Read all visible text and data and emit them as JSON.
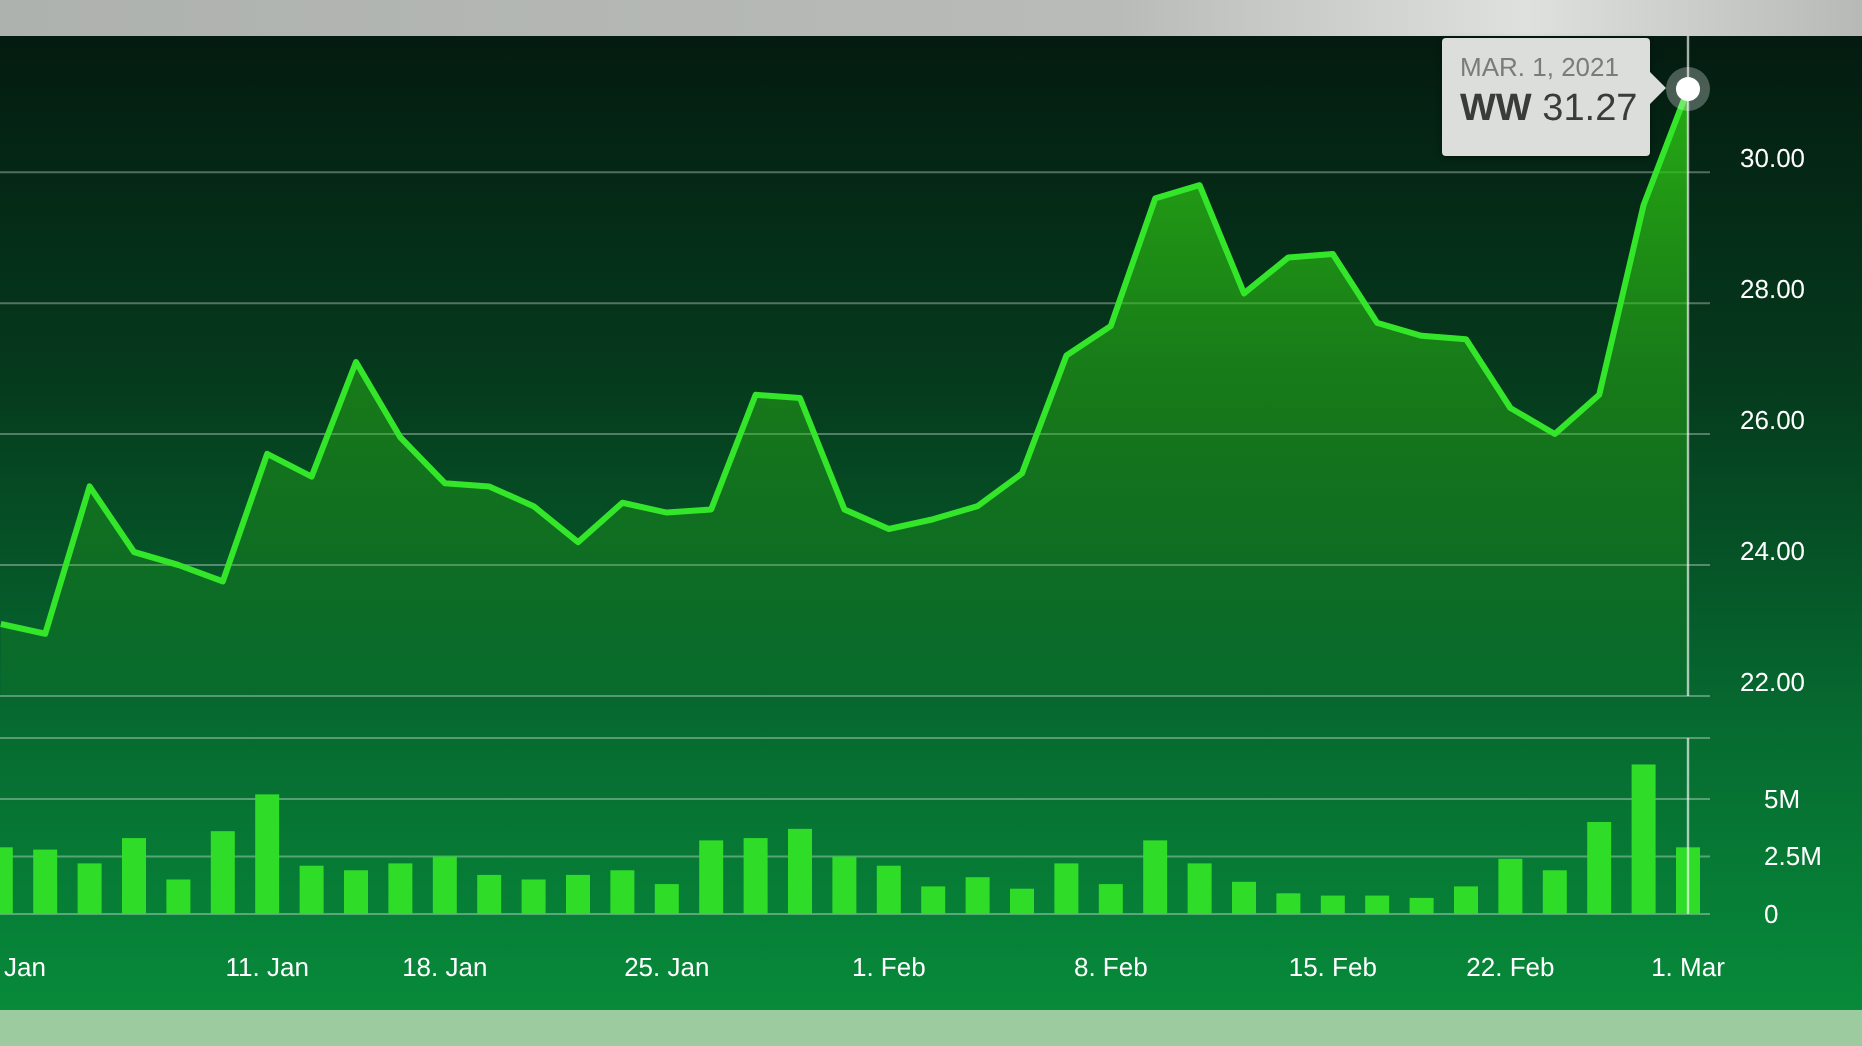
{
  "price_chart": {
    "chart_data": {
      "type": "area",
      "grid": true,
      "series": [
        {
          "color": "#33e62a",
          "values": [
            23.1,
            22.95,
            25.2,
            24.2,
            24.0,
            23.75,
            25.7,
            25.35,
            27.1,
            25.95,
            25.25,
            25.2,
            24.9,
            24.35,
            24.95,
            24.8,
            24.85,
            26.6,
            26.55,
            24.85,
            24.55,
            24.7,
            24.9,
            25.4,
            27.2,
            27.65,
            29.6,
            29.8,
            28.15,
            28.7,
            28.75,
            27.7,
            27.5,
            27.45,
            26.4,
            26.0,
            26.6,
            29.5,
            31.27
          ]
        }
      ],
      "ylim": [
        22,
        32.08
      ],
      "yticks": [
        {
          "value": 22,
          "label": "22.00"
        },
        {
          "value": 24,
          "label": "24.00"
        },
        {
          "value": 26,
          "label": "26.00"
        },
        {
          "value": 28,
          "label": "28.00"
        },
        {
          "value": 30,
          "label": "30.00"
        }
      ]
    },
    "tooltip": {
      "date": "MAR. 1, 2021",
      "text": "**WW** 31.27"
    }
  },
  "volume_chart": {
    "chart_data": {
      "type": "bar",
      "grid": true,
      "categories": [
        "Jan",
        null,
        null,
        null,
        null,
        null,
        "11. Jan",
        null,
        null,
        null,
        "18. Jan",
        null,
        null,
        null,
        null,
        "25. Jan",
        null,
        null,
        null,
        null,
        "1. Feb",
        null,
        null,
        null,
        null,
        "8. Feb",
        null,
        null,
        null,
        null,
        "15. Feb",
        null,
        null,
        null,
        "22. Feb",
        null,
        null,
        null,
        "1. Mar"
      ],
      "series": [
        {
          "color": "#2fdc28",
          "values": [
            2.9,
            2.8,
            2.2,
            3.3,
            1.5,
            3.6,
            5.2,
            2.1,
            1.9,
            2.2,
            2.5,
            1.7,
            1.5,
            1.7,
            1.9,
            1.3,
            3.2,
            3.3,
            3.7,
            2.5,
            2.1,
            1.2,
            1.6,
            1.1,
            2.2,
            1.3,
            3.2,
            2.2,
            1.4,
            0.9,
            0.8,
            0.8,
            0.7,
            1.2,
            2.4,
            1.9,
            4.0,
            6.5,
            2.9
          ]
        }
      ],
      "ylim": [
        0,
        7.65
      ],
      "yticks": [
        {
          "value": 0,
          "label": "0"
        },
        {
          "value": 2.5,
          "label": "2.5M"
        },
        {
          "value": 5,
          "label": "5M"
        }
      ]
    }
  }
}
